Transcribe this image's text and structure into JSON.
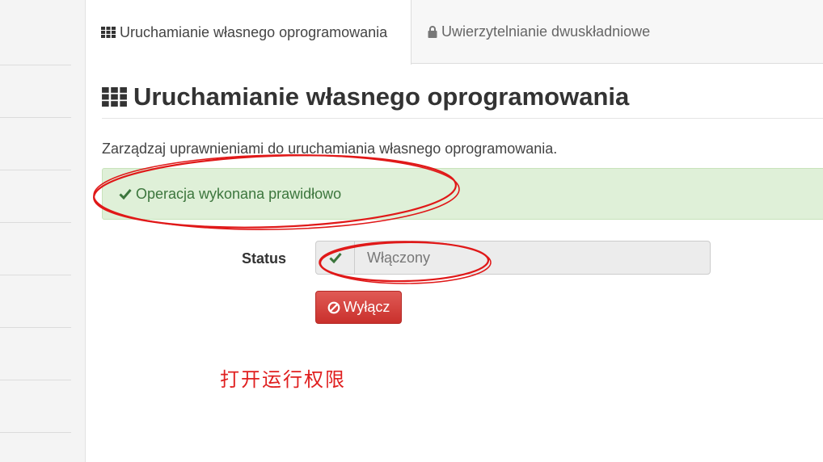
{
  "tabs": [
    {
      "label": "Uruchamianie własnego oprogramowania",
      "icon": "grid-icon",
      "active": true
    },
    {
      "label": "Uwierzytelnianie dwuskładniowe",
      "icon": "lock-icon",
      "active": false
    }
  ],
  "page": {
    "title": "Uruchamianie własnego oprogramowania",
    "description": "Zarządzaj uprawnieniami do uruchamiania własnego oprogramowania."
  },
  "alert": {
    "message": "Operacja wykonana prawidłowo",
    "icon": "check-icon",
    "color": "#3c763d"
  },
  "status": {
    "label": "Status",
    "value": "Włączony",
    "icon": "check-icon"
  },
  "actions": {
    "disable_label": "Wyłącz",
    "disable_icon": "ban-icon",
    "disable_color": "#d9534f"
  },
  "annotation": {
    "note": "打开运行权限",
    "color": "#e02020"
  }
}
